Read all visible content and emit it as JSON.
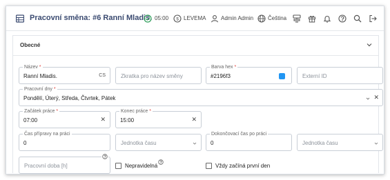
{
  "header": {
    "title": "Pracovní směna: #6 Ranní Mladis.",
    "time": "05:00",
    "company": "LEVEMA",
    "user": "Admin Admin",
    "language": "Čeština"
  },
  "section": {
    "title": "Obecné"
  },
  "form": {
    "name": {
      "label": "Název",
      "value": "Ranní Mladis.",
      "lang": "CS"
    },
    "short_name": {
      "placeholder": "Zkratka pro název směny"
    },
    "color_hex": {
      "label": "Barva hex",
      "value": "#2196f3",
      "swatch": "#2196f3"
    },
    "external_id": {
      "placeholder": "Externí ID"
    },
    "work_days": {
      "label": "Pracovní dny",
      "value": "Pondělí, Úterý, Středa, Čtvrtek, Pátek"
    },
    "start": {
      "label": "Začátek práce",
      "value": "07:00"
    },
    "end": {
      "label": "Konec práce",
      "value": "15:00"
    },
    "prep_time": {
      "label": "Čas přípravy na práci",
      "value": "0"
    },
    "prep_unit": {
      "placeholder": "Jednotka času"
    },
    "finish_time": {
      "label": "Dokončovací čas po práci",
      "value": "0"
    },
    "finish_unit": {
      "placeholder": "Jednotka času"
    },
    "work_hours": {
      "placeholder": "Pracovní doba [h]"
    },
    "irregular": {
      "label": "Nepravidelná"
    },
    "always_first_day": {
      "label": "Vždy začíná první den"
    }
  },
  "colors": {
    "accent": "#3a4a70",
    "success": "#2e9e5a",
    "required": "#e0403a"
  }
}
